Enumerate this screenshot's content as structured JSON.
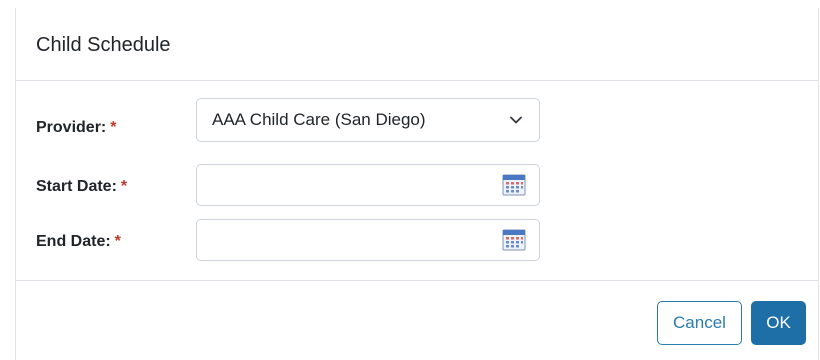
{
  "dialog": {
    "title": "Child Schedule"
  },
  "form": {
    "provider": {
      "label": "Provider:",
      "required_marker": "*",
      "selected": "AAA Child Care (San Diego)",
      "icon": "chevron-down-icon"
    },
    "start_date": {
      "label": "Start Date:",
      "required_marker": "*",
      "value": "",
      "icon": "calendar-icon"
    },
    "end_date": {
      "label": "End Date:",
      "required_marker": "*",
      "value": "",
      "icon": "calendar-icon"
    }
  },
  "footer": {
    "cancel_label": "Cancel",
    "ok_label": "OK"
  },
  "colors": {
    "primary": "#1e6fa8",
    "required": "#c0392b",
    "border": "#ced4da"
  }
}
